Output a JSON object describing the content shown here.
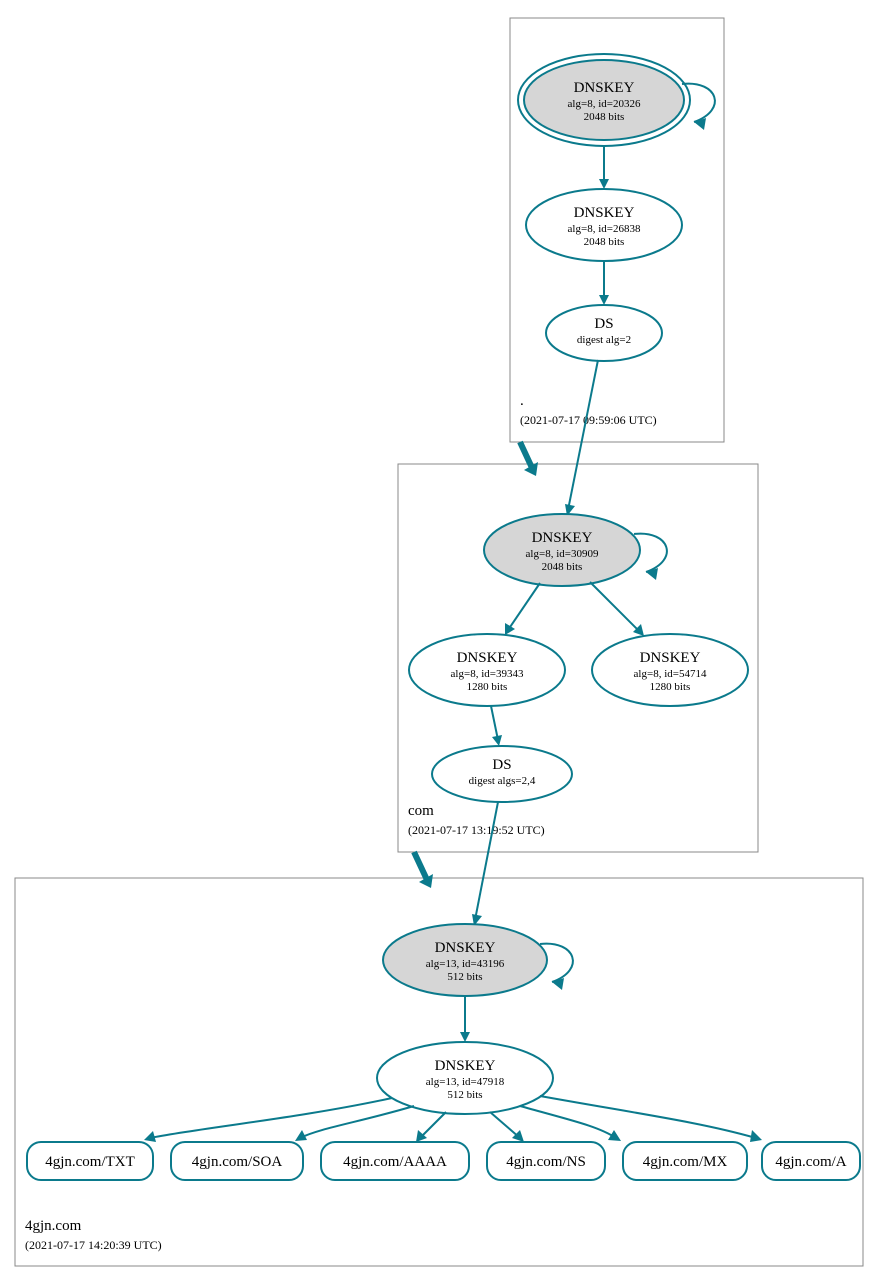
{
  "colors": {
    "teal": "#0b7a8c",
    "grey_fill": "#d6d6d6",
    "white": "#ffffff",
    "box": "#888888"
  },
  "zones": {
    "root": {
      "name": ".",
      "time": "(2021-07-17 09:59:06 UTC)"
    },
    "com": {
      "name": "com",
      "time": "(2021-07-17 13:19:52 UTC)"
    },
    "leaf": {
      "name": "4gjn.com",
      "time": "(2021-07-17 14:20:39 UTC)"
    }
  },
  "nodes": {
    "root_ksk": {
      "l1": "DNSKEY",
      "l2": "alg=8, id=20326",
      "l3": "2048 bits"
    },
    "root_zsk": {
      "l1": "DNSKEY",
      "l2": "alg=8, id=26838",
      "l3": "2048 bits"
    },
    "root_ds": {
      "l1": "DS",
      "l2": "digest alg=2"
    },
    "com_ksk": {
      "l1": "DNSKEY",
      "l2": "alg=8, id=30909",
      "l3": "2048 bits"
    },
    "com_zskA": {
      "l1": "DNSKEY",
      "l2": "alg=8, id=39343",
      "l3": "1280 bits"
    },
    "com_zskB": {
      "l1": "DNSKEY",
      "l2": "alg=8, id=54714",
      "l3": "1280 bits"
    },
    "com_ds": {
      "l1": "DS",
      "l2": "digest algs=2,4"
    },
    "leaf_ksk": {
      "l1": "DNSKEY",
      "l2": "alg=13, id=43196",
      "l3": "512 bits"
    },
    "leaf_zsk": {
      "l1": "DNSKEY",
      "l2": "alg=13, id=47918",
      "l3": "512 bits"
    }
  },
  "records": {
    "r0": "4gjn.com/TXT",
    "r1": "4gjn.com/SOA",
    "r2": "4gjn.com/AAAA",
    "r3": "4gjn.com/NS",
    "r4": "4gjn.com/MX",
    "r5": "4gjn.com/A"
  }
}
